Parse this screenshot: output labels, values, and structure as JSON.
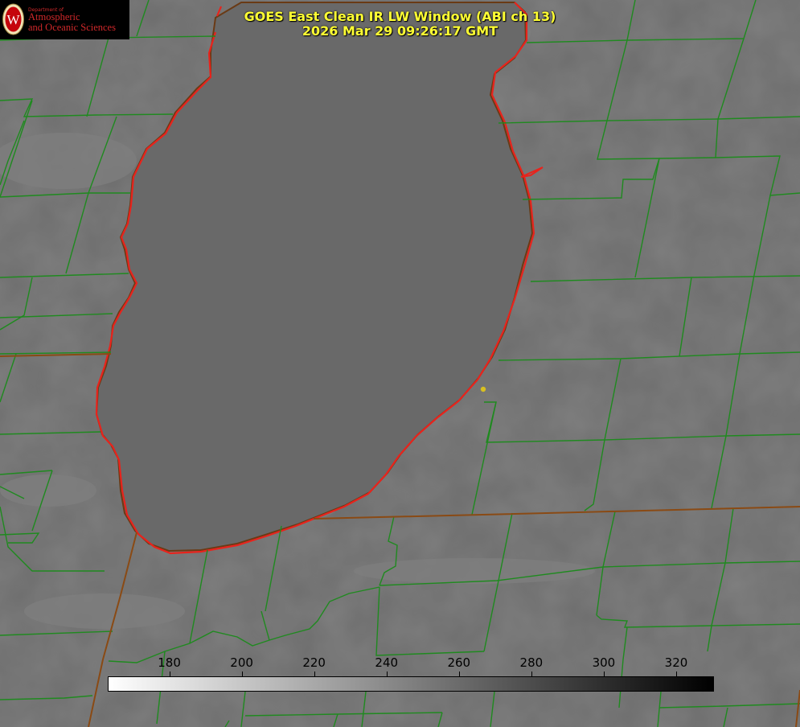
{
  "header": {
    "title_line1": "GOES East Clean IR LW Window (ABI ch 13)",
    "title_line2": "2026 Mar 29 09:26:17 GMT"
  },
  "logo": {
    "department": "Department of",
    "line1": "Atmospheric",
    "line2": "and Oceanic Sciences",
    "seal_letter": "W"
  },
  "colorbar": {
    "ticks": [
      "180",
      "200",
      "220",
      "240",
      "260",
      "280",
      "300",
      "320"
    ],
    "tick_values": [
      180,
      200,
      220,
      240,
      260,
      280,
      300,
      320
    ],
    "range": [
      163,
      330
    ],
    "low_color": "#ffffff",
    "high_color": "#000000"
  },
  "colors": {
    "title": "#ffff33",
    "county_lines": "#1f8a1f",
    "lake_shore": "#e8231c",
    "background_gray": "#6e6e6e",
    "lake_gray": "#6a6a6a",
    "city_marker": "#d8c020"
  },
  "map": {
    "feature": "lake-outline",
    "city_marker": "city-dot"
  }
}
